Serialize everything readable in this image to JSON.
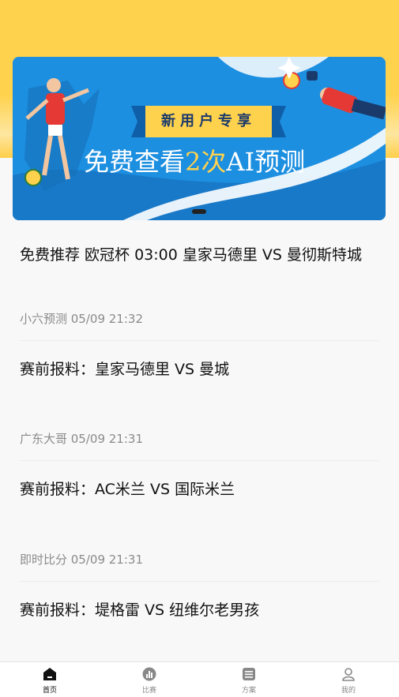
{
  "banner": {
    "tag": "新用户专享",
    "headline_prefix": "免费查看",
    "headline_highlight": "2次",
    "headline_suffix": "AI预测",
    "colors": {
      "bg": "#1d8fe0",
      "accent": "#ffd24d"
    }
  },
  "featured": {
    "title": "免费推荐 欧冠杯 03:00 皇家马德里 VS 曼彻斯特城"
  },
  "items": [
    {
      "meta": "小六预测 05/09 21:32",
      "title": "赛前报料：皇家马德里 VS 曼城"
    },
    {
      "meta": "广东大哥 05/09 21:31",
      "title": "赛前报料：AC米兰 VS 国际米兰"
    },
    {
      "meta": "即时比分 05/09 21:31",
      "title": "赛前报料：堤格雷 VS 纽维尔老男孩"
    }
  ],
  "tabbar": {
    "tabs": [
      {
        "label": "首页",
        "icon": "home-icon"
      },
      {
        "label": "比赛",
        "icon": "stats-icon"
      },
      {
        "label": "方案",
        "icon": "list-icon"
      },
      {
        "label": "我的",
        "icon": "user-icon"
      }
    ]
  }
}
